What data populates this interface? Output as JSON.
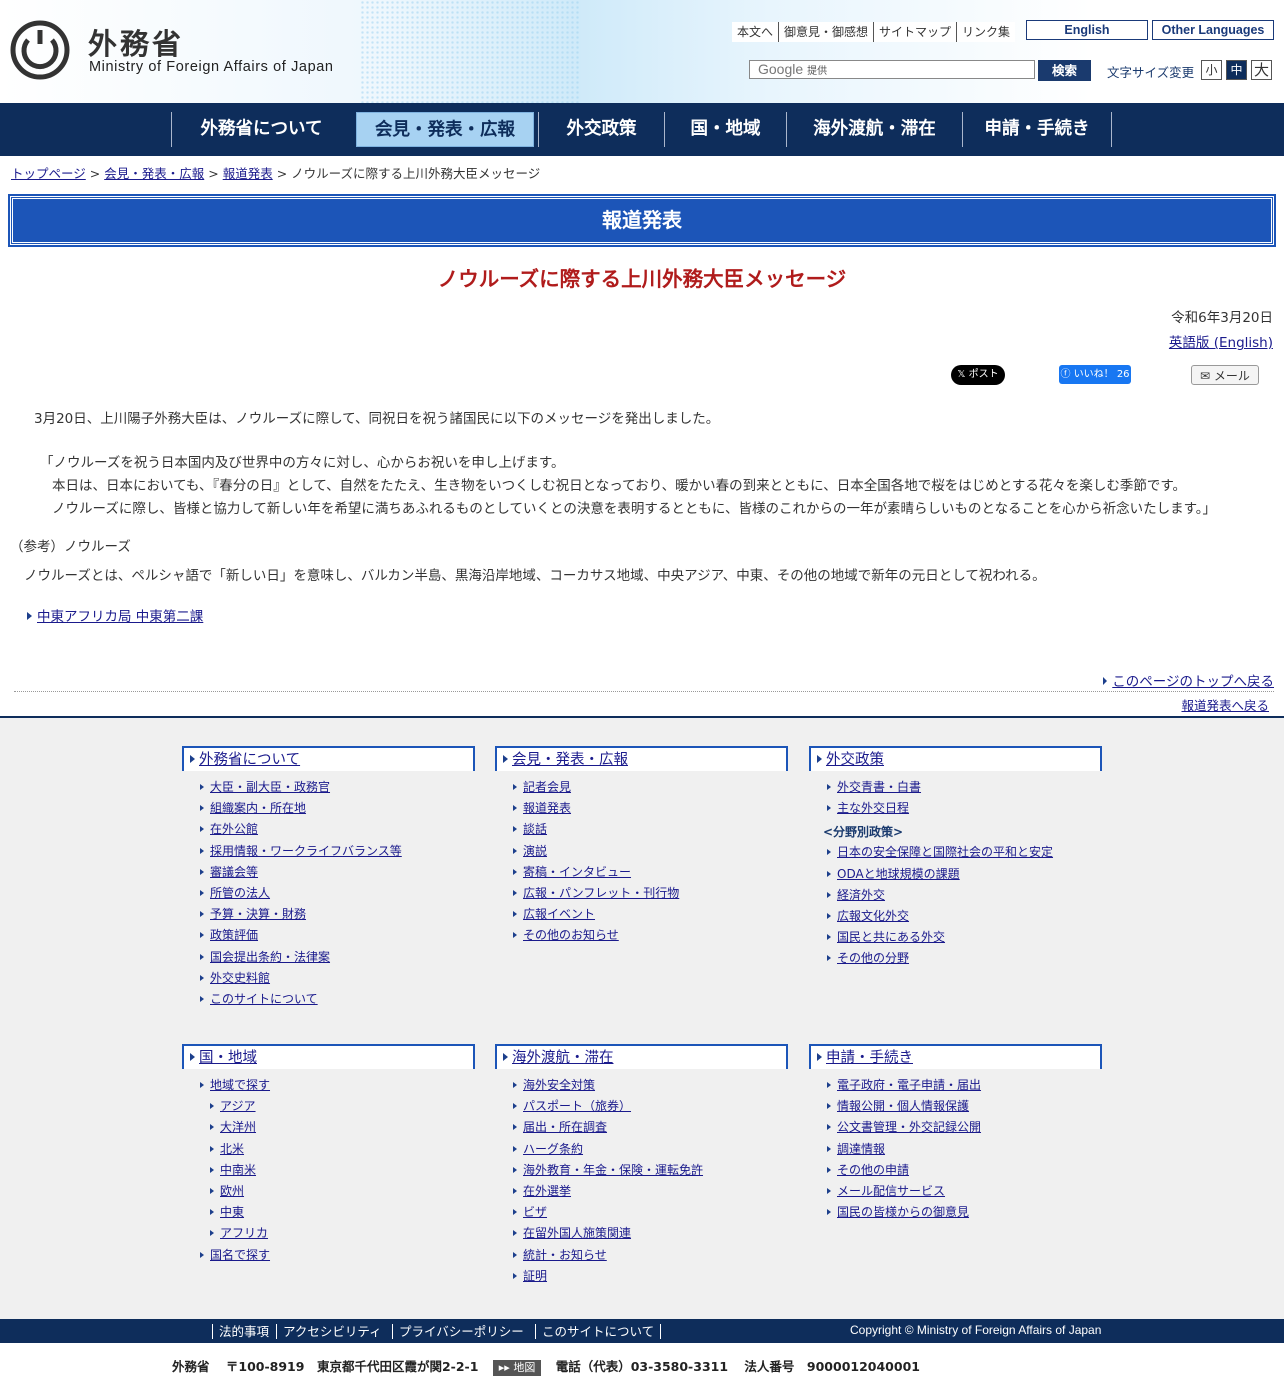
{
  "header": {
    "ja_name": "外務省",
    "en_name": "Ministry of Foreign Affairs of Japan",
    "top_links": [
      "本文へ",
      "御意見・御感想",
      "サイトマップ",
      "リンク集"
    ],
    "english_btn": "English",
    "other_lang_btn": "Other Languages",
    "search_brand": "Google",
    "search_provided": "提供",
    "search_btn": "検索",
    "font_size_label": "文字サイズ変更",
    "font_sizes": [
      "小",
      "中",
      "大"
    ]
  },
  "nav": {
    "items": [
      "外務省について",
      "会見・発表・広報",
      "外交政策",
      "国・地域",
      "海外渡航・滞在",
      "申請・手続き"
    ],
    "active": "会見・発表・広報"
  },
  "breadcrumb": {
    "items": [
      "トップページ",
      "会見・発表・広報",
      "報道発表"
    ],
    "current": "ノウルーズに際する上川外務大臣メッセージ",
    "sep": ">"
  },
  "section_title": "報道発表",
  "article": {
    "title": "ノウルーズに際する上川外務大臣メッセージ",
    "date": "令和6年3月20日",
    "en_link": "英語版 (English)",
    "share": {
      "x": "ポスト",
      "fb": "いいね！ 26",
      "mail": "メール"
    },
    "intro": "3月20日、上川陽子外務大臣は、ノウルーズに際して、同祝日を祝う諸国民に以下のメッセージを発出しました。",
    "message": [
      "「ノウルーズを祝う日本国内及び世界中の方々に対し、心からお祝いを申し上げます。",
      "本日は、日本においても、『春分の日』として、自然をたたえ、生き物をいつくしむ祝日となっており、暖かい春の到来とともに、日本全国各地で桜をはじめとする花々を楽しむ季節です。",
      "ノウルーズに際し、皆様と協力して新しい年を希望に満ちあふれるものとしていくとの決意を表明するとともに、皆様のこれからの一年が素晴らしいものとなることを心から祈念いたします。」"
    ],
    "ref_label": "（参考）ノウルーズ",
    "ref_text": "ノウルーズとは、ペルシャ語で「新しい日」を意味し、バルカン半島、黒海沿岸地域、コーカサス地域、中央アジア、中東、その他の地域で新年の元日として祝われる。",
    "bureau_link": "中東アフリカ局 中東第二課",
    "page_top": "このページのトップへ戻る",
    "back_link": "報道発表へ戻る"
  },
  "footer": {
    "columns": [
      {
        "title": "外務省について",
        "items": [
          "大臣・副大臣・政務官",
          "組織案内・所在地",
          "在外公館",
          "採用情報・ワークライフバランス等",
          "審議会等",
          "所管の法人",
          "予算・決算・財務",
          "政策評価",
          "国会提出条約・法律案",
          "外交史料館",
          "このサイトについて"
        ]
      },
      {
        "title": "会見・発表・広報",
        "items": [
          "記者会見",
          "報道発表",
          "談話",
          "演説",
          "寄稿・インタビュー",
          "広報・パンフレット・刊行物",
          "広報イベント",
          "その他のお知らせ"
        ]
      },
      {
        "title": "外交政策",
        "items": [
          "外交青書・白書",
          "主な外交日程"
        ],
        "category": "<分野別政策>",
        "cat_items": [
          "日本の安全保障と国際社会の平和と安定",
          "ODAと地球規模の課題",
          "経済外交",
          "広報文化外交",
          "国民と共にある外交",
          "その他の分野"
        ]
      },
      {
        "title": "国・地域",
        "items": [
          "地域で探す"
        ],
        "sub_items": [
          "アジア",
          "大洋州",
          "北米",
          "中南米",
          "欧州",
          "中東",
          "アフリカ"
        ],
        "after_items": [
          "国名で探す"
        ]
      },
      {
        "title": "海外渡航・滞在",
        "items": [
          "海外安全対策",
          "パスポート（旅券）",
          "届出・所在調査",
          "ハーグ条約",
          "海外教育・年金・保険・運転免許",
          "在外選挙",
          "ビザ",
          "在留外国人施策関連",
          "統計・お知らせ",
          "証明"
        ]
      },
      {
        "title": "申請・手続き",
        "items": [
          "電子政府・電子申請・届出",
          "情報公開・個人情報保護",
          "公文書管理・外交記録公開",
          "調達情報",
          "その他の申請",
          "メール配信サービス",
          "国民の皆様からの御意見"
        ]
      }
    ],
    "bottom_links": [
      "法的事項",
      "アクセシビリティ",
      "プライバシーポリシー",
      "このサイトについて"
    ],
    "copyright": "Copyright © Ministry of Foreign Affairs of Japan",
    "address_name": "外務省",
    "address": "〒100-8919　東京都千代田区霞が関2-2-1",
    "map_btn": "▸▸ 地図",
    "phone": "電話（代表）03-3580-3311",
    "corp_no": "法人番号　9000012040001"
  },
  "colors": {
    "navy": "#0e2d5b",
    "accent_blue": "#1c55b8",
    "title_red": "#b01c1c",
    "nav_active": "#a7d2f2"
  }
}
